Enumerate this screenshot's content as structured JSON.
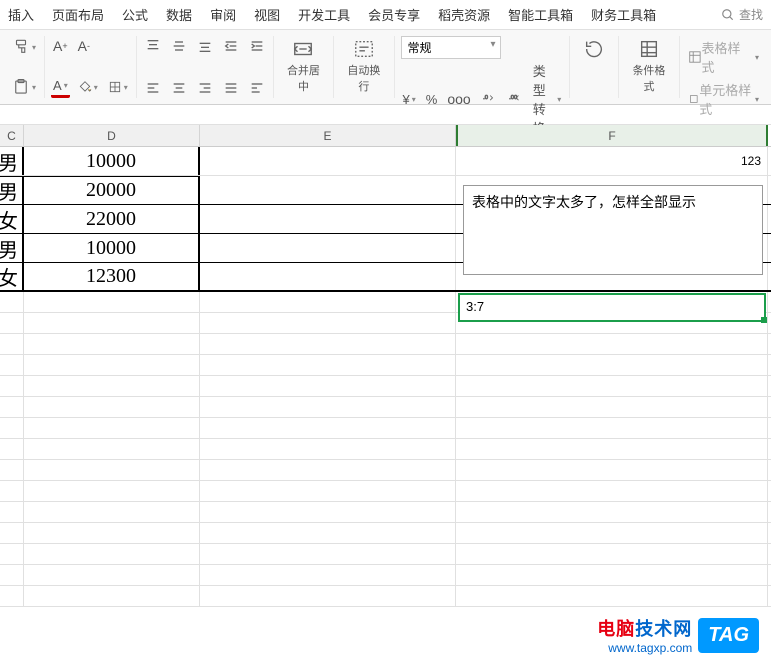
{
  "tabs": [
    "插入",
    "页面布局",
    "公式",
    "数据",
    "审阅",
    "视图",
    "开发工具",
    "会员专享",
    "稻壳资源",
    "智能工具箱",
    "财务工具箱"
  ],
  "search_label": "查找",
  "toolbar": {
    "merge_label": "合并居中",
    "wrap_label": "自动换行",
    "format_label": "常规",
    "type_convert": "类型转换",
    "cond_format": "条件格式",
    "table_style": "表格样式",
    "cell_style": "单元格样式"
  },
  "columns": {
    "c": "C",
    "d": "D",
    "e": "E",
    "f": "F"
  },
  "cells": {
    "c": [
      "男",
      "男",
      "女",
      "男",
      "女"
    ],
    "d": [
      "10000",
      "20000",
      "22000",
      "10000",
      "12300"
    ],
    "f1": "123",
    "f2_box": "表格中的文字太多了，怎样全部显示",
    "f_selected": "3:7"
  },
  "watermark": {
    "title_red": "电脑",
    "title_blue": "技术网",
    "url": "www.tagxp.com",
    "tag": "TAG"
  }
}
